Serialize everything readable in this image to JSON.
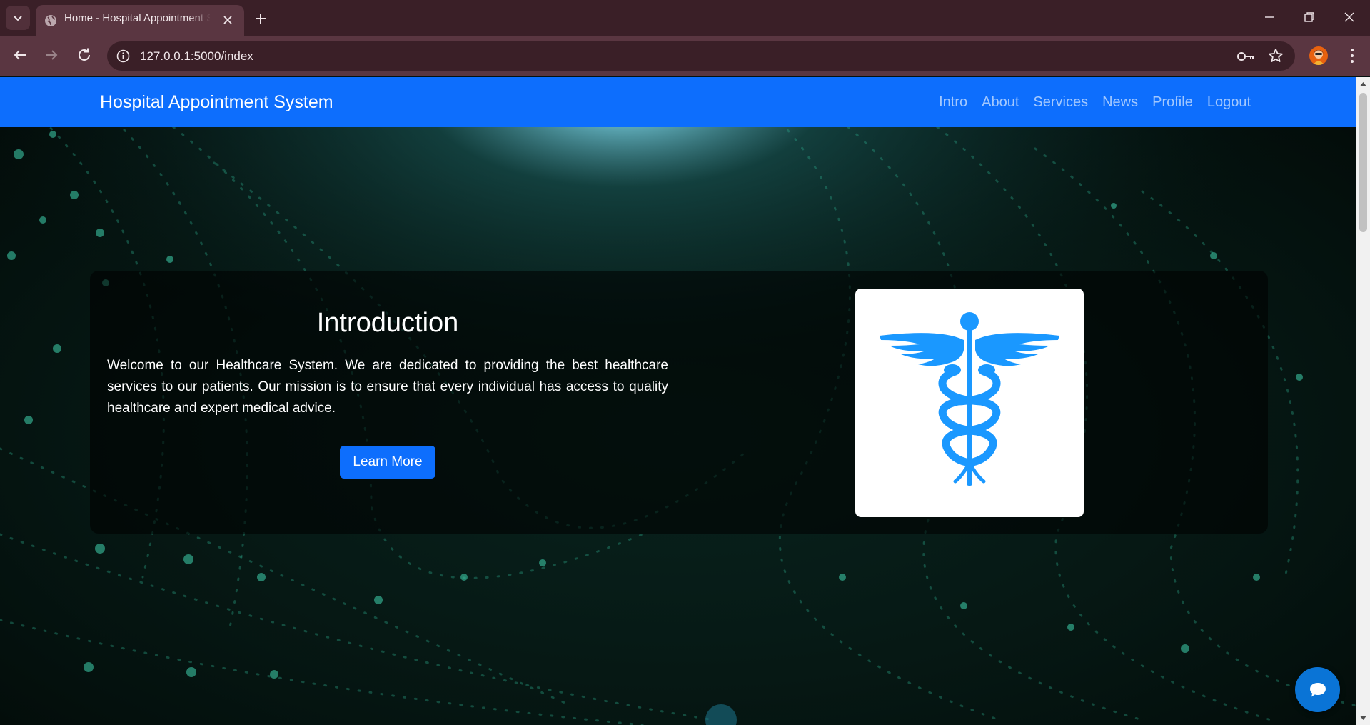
{
  "browser": {
    "tab_title": "Home - Hospital Appointment System",
    "url": "127.0.0.1:5000/index"
  },
  "navbar": {
    "brand": "Hospital Appointment System",
    "links": [
      "Intro",
      "About",
      "Services",
      "News",
      "Profile",
      "Logout"
    ]
  },
  "intro": {
    "heading": "Introduction",
    "text": "Welcome to our Healthcare System. We are dedicated to providing the best healthcare services to our patients. Our mission is to ensure that every individual has access to quality healthcare and expert medical advice.",
    "button_label": "Learn More",
    "image_icon": "caduceus-icon"
  },
  "colors": {
    "navbar": "#0d6efd",
    "button": "#0d6efd",
    "caduceus": "#1a98ff",
    "chat_button": "#0a74d6",
    "browser_frame": "#3a1f27"
  },
  "icons": {
    "chat": "chat-bubble-icon"
  }
}
